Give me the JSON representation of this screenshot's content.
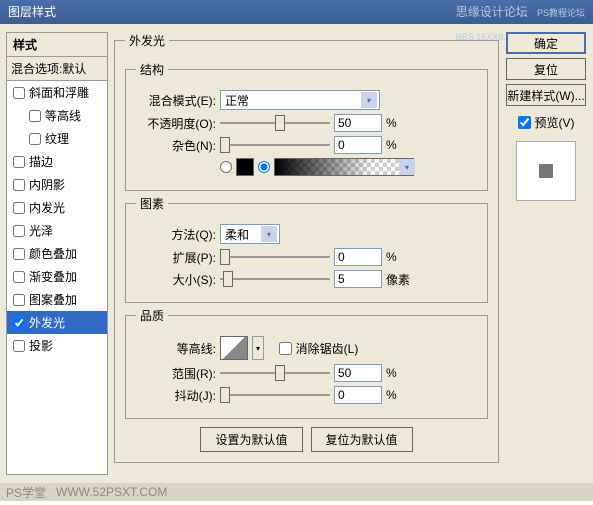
{
  "title": "图层样式",
  "watermark_top_1": "思缘设计论坛",
  "watermark_top_2": "PS教程论坛\nBBS.16XX8.COM",
  "watermark_bottom_1": "PS学堂",
  "watermark_bottom_2": "WWW.52PSXT.COM",
  "styles": {
    "header": "样式",
    "blending": "混合选项:默认",
    "items": [
      {
        "label": "斜面和浮雕",
        "checked": false,
        "indent": 0
      },
      {
        "label": "等高线",
        "checked": false,
        "indent": 1
      },
      {
        "label": "纹理",
        "checked": false,
        "indent": 1
      },
      {
        "label": "描边",
        "checked": false,
        "indent": 0
      },
      {
        "label": "内阴影",
        "checked": false,
        "indent": 0
      },
      {
        "label": "内发光",
        "checked": false,
        "indent": 0
      },
      {
        "label": "光泽",
        "checked": false,
        "indent": 0
      },
      {
        "label": "颜色叠加",
        "checked": false,
        "indent": 0
      },
      {
        "label": "渐变叠加",
        "checked": false,
        "indent": 0
      },
      {
        "label": "图案叠加",
        "checked": false,
        "indent": 0
      },
      {
        "label": "外发光",
        "checked": true,
        "indent": 0,
        "selected": true
      },
      {
        "label": "投影",
        "checked": false,
        "indent": 0
      }
    ]
  },
  "main": {
    "groupTitle": "外发光",
    "structure": {
      "legend": "结构",
      "blendModeLabel": "混合模式(E):",
      "blendModeValue": "正常",
      "opacityLabel": "不透明度(O):",
      "opacityValue": "50",
      "opacityUnit": "%",
      "noiseLabel": "杂色(N):",
      "noiseValue": "0",
      "noiseUnit": "%"
    },
    "elements": {
      "legend": "图素",
      "techniqueLabel": "方法(Q):",
      "techniqueValue": "柔和",
      "spreadLabel": "扩展(P):",
      "spreadValue": "0",
      "spreadUnit": "%",
      "sizeLabel": "大小(S):",
      "sizeValue": "5",
      "sizeUnit": "像素"
    },
    "quality": {
      "legend": "品质",
      "contourLabel": "等高线:",
      "antiAliasLabel": "消除锯齿(L)",
      "rangeLabel": "范围(R):",
      "rangeValue": "50",
      "rangeUnit": "%",
      "jitterLabel": "抖动(J):",
      "jitterValue": "0",
      "jitterUnit": "%"
    },
    "defaultBtns": {
      "setDefault": "设置为默认值",
      "resetDefault": "复位为默认值"
    }
  },
  "right": {
    "ok": "确定",
    "cancel": "复位",
    "newStyle": "新建样式(W)...",
    "previewLabel": "预览(V)"
  }
}
